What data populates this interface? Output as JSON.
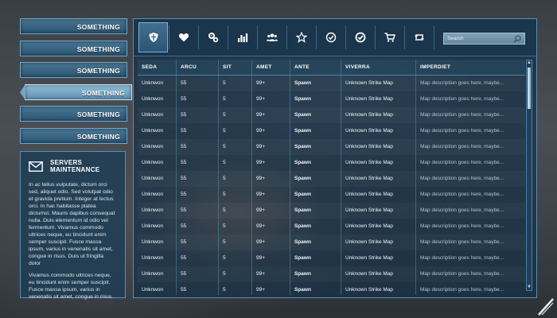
{
  "menu": {
    "items": [
      {
        "label": "SOMETHING"
      },
      {
        "label": "SOMETHING"
      },
      {
        "label": "SOMETHING"
      },
      {
        "label": "SOMETHING"
      },
      {
        "label": "SOMETHING"
      },
      {
        "label": "SOMETHING"
      }
    ],
    "active_index": 3
  },
  "info": {
    "title_line1": "SERVERS",
    "title_line2": "MAINTENANCE",
    "icon": "mail-icon",
    "paragraph1": "In ac tellus vulputate, dictum orci sed, aliquet odio. Sed volutpat odio et gravida pretium. Integer at lectus orci. In hac habitasse platea dictumst. Mauris dapibus consequat nulla. Duis elementum id odio vel fermentum. Vivamus commodo ultrices neque, eu tincidunt enim semper suscipit. Fusce massa ipsum, varius in venenatis sit amet, congue in risus. Duis ut fringilla dolor",
    "paragraph2": "Vivamus commodo ultrices neque, eu tincidunt enim semper suscipit. Fusce massa ipsum, varius in venenatis sit amet, congue in risus."
  },
  "toolbar": {
    "icons": [
      "shield-icon",
      "heart-icon",
      "gears-icon",
      "bar-chart-icon",
      "users-icon",
      "star-icon",
      "check-circle-icon",
      "check-circle-filled-icon",
      "cart-icon",
      "retweet-icon"
    ],
    "search_placeholder": "Search"
  },
  "table": {
    "headers": [
      "SEDA",
      "ARCU",
      "SIT",
      "AMET",
      "ANTE",
      "VIVERRA",
      "IMPERDIET"
    ],
    "rows": [
      [
        "Unknwon",
        "55",
        "5",
        "99+",
        "Spawn",
        "Unknown Strike Map",
        "Map description goes here, maybe..."
      ],
      [
        "Unknwon",
        "55",
        "5",
        "99+",
        "Spawn",
        "Unknown Strike Map",
        "Map description goes here, maybe..."
      ],
      [
        "Unknwon",
        "55",
        "5",
        "99+",
        "Spawn",
        "Unknown Strike Map",
        "Map description goes here, maybe..."
      ],
      [
        "Unknwon",
        "55",
        "5",
        "99+",
        "Spawn",
        "Unknown Strike Map",
        "Map description goes here, maybe..."
      ],
      [
        "Unknwon",
        "55",
        "5",
        "99+",
        "Spawn",
        "Unknown Strike Map",
        "Map description goes here, maybe..."
      ],
      [
        "Unknwon",
        "55",
        "5",
        "99+",
        "Spawn",
        "Unknown Strike Map",
        "Map description goes here, maybe..."
      ],
      [
        "Unknwon",
        "55",
        "5",
        "99+",
        "Spawn",
        "Unknown Strike Map",
        "Map description goes here, maybe..."
      ],
      [
        "Unknwon",
        "55",
        "5",
        "99+",
        "Spawn",
        "Unknown Strike Map",
        "Map description goes here, maybe..."
      ],
      [
        "Unknwon",
        "55",
        "5",
        "99+",
        "Spawn",
        "Unknown Strike Map",
        "Map description goes here, maybe..."
      ],
      [
        "Unknwon",
        "55",
        "5",
        "99+",
        "Spawn",
        "Unknown Strike Map",
        "Map description goes here, maybe..."
      ],
      [
        "Unknwon",
        "55",
        "5",
        "99+",
        "Spawn",
        "Unknown Strike Map",
        "Map description goes here, maybe..."
      ],
      [
        "Unknwon",
        "55",
        "5",
        "99+",
        "Spawn",
        "Unknown Strike Map",
        "Map description goes here, maybe..."
      ],
      [
        "Unknwon",
        "55",
        "5",
        "99+",
        "Spawn",
        "Unknown Strike Map",
        "Map description goes here, maybe..."
      ],
      [
        "Unknwon",
        "55",
        "5",
        "99+",
        "Spawn",
        "Unknown Strike Map",
        "Map description goes here, maybe..."
      ]
    ]
  },
  "colors": {
    "accent": "#5a8db0",
    "panel": "#16304a",
    "text": "#f2f6f9"
  }
}
